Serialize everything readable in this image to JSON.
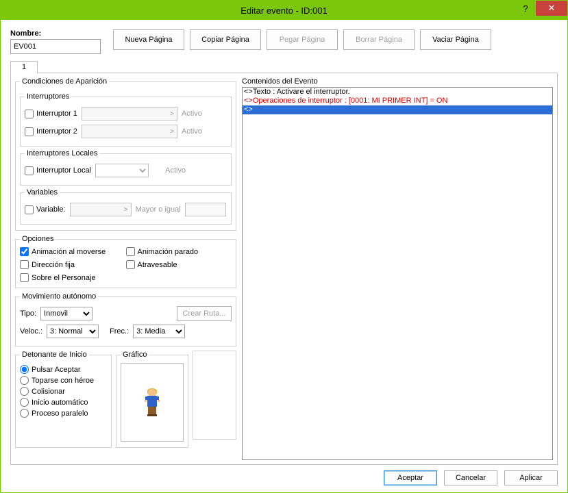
{
  "window": {
    "title": "Editar evento - ID:001",
    "help": "?",
    "close": "✕"
  },
  "name": {
    "label": "Nombre:",
    "value": "EV001"
  },
  "page_buttons": {
    "new": "Nueva Página",
    "copy": "Copiar Página",
    "paste": "Pegar Página",
    "delete": "Borrar Página",
    "clear": "Vaciar Página"
  },
  "tabs": [
    "1"
  ],
  "cond": {
    "legend": "Condiciones de Aparición",
    "switches": {
      "legend": "Interruptores",
      "sw1": "Interruptor 1",
      "sw2": "Interruptor 2",
      "active": "Activo"
    },
    "local": {
      "legend": "Interruptores Locales",
      "label": "Interruptor Local",
      "active": "Activo"
    },
    "vars": {
      "legend": "Variables",
      "label": "Variable:",
      "gte": "Mayor o igual"
    }
  },
  "options": {
    "legend": "Opciones",
    "move_anim": "Animación al moverse",
    "stop_anim": "Animación parado",
    "fix_dir": "Dirección fija",
    "through": "Atravesable",
    "above": "Sobre el Personaje"
  },
  "autonomous": {
    "legend": "Movimiento autónomo",
    "type_label": "Tipo:",
    "type_value": "Inmovil",
    "route": "Crear Ruta...",
    "speed_label": "Veloc.:",
    "speed_value": "3: Normal",
    "freq_label": "Frec.:",
    "freq_value": "3: Media"
  },
  "trigger": {
    "legend": "Detonante de Inicio",
    "opts": [
      "Pulsar Aceptar",
      "Toparse con héroe",
      "Colisionar",
      "Inicio automático",
      "Proceso paralelo"
    ],
    "selected": 0
  },
  "graphic": {
    "legend": "Gráfico"
  },
  "contents": {
    "legend": "Contenidos del Evento",
    "lines": [
      {
        "text": "<>Texto : Activare el interruptor.",
        "style": "normal"
      },
      {
        "text": "<>Operaciones de interruptor : [0001: MI PRIMER INT] = ON",
        "style": "red"
      },
      {
        "text": "<>",
        "style": "selected"
      }
    ]
  },
  "footer": {
    "ok": "Aceptar",
    "cancel": "Cancelar",
    "apply": "Aplicar"
  }
}
